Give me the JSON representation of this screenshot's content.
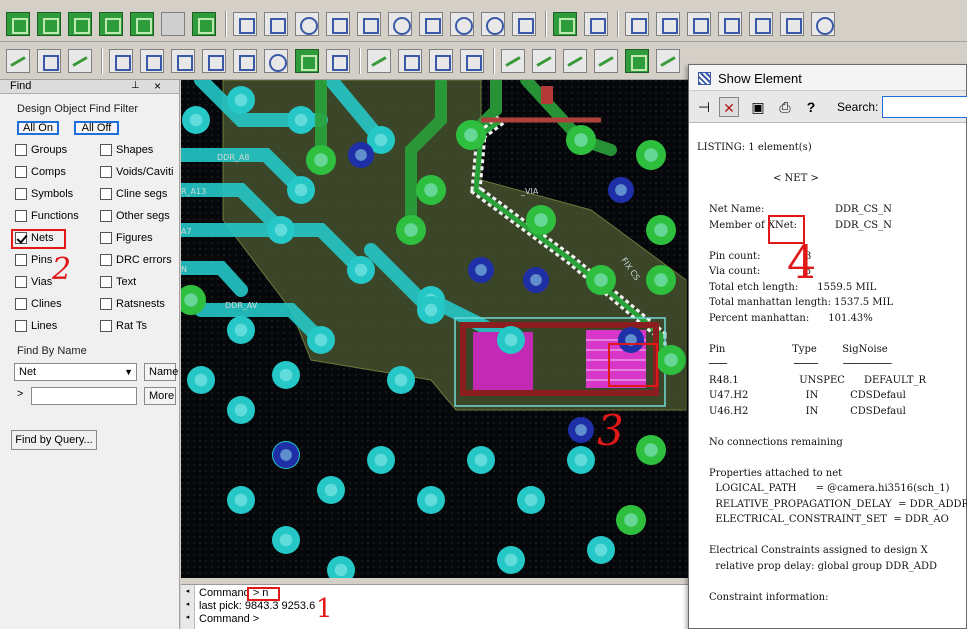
{
  "find_panel": {
    "title": "Find",
    "filter_group_label": "Design Object Find Filter",
    "all_on_label": "All On",
    "all_off_label": "All Off",
    "checkboxes_left": [
      {
        "label": "Groups",
        "checked": false
      },
      {
        "label": "Comps",
        "checked": false
      },
      {
        "label": "Symbols",
        "checked": false
      },
      {
        "label": "Functions",
        "checked": false
      },
      {
        "label": "Nets",
        "checked": true
      },
      {
        "label": "Pins",
        "checked": false
      },
      {
        "label": "Vias",
        "checked": false
      },
      {
        "label": "Clines",
        "checked": false
      },
      {
        "label": "Lines",
        "checked": false
      }
    ],
    "checkboxes_right": [
      {
        "label": "Shapes",
        "checked": false
      },
      {
        "label": "Voids/Caviti",
        "checked": false
      },
      {
        "label": "Cline segs",
        "checked": false
      },
      {
        "label": "Other segs",
        "checked": false
      },
      {
        "label": "Figures",
        "checked": false
      },
      {
        "label": "DRC errors",
        "checked": false
      },
      {
        "label": "Text",
        "checked": false
      },
      {
        "label": "Ratsnests",
        "checked": false
      },
      {
        "label": "Rat Ts",
        "checked": false
      }
    ],
    "find_by_name_label": "Find By Name",
    "type_selected": "Net",
    "name_button_label": "Name",
    "more_button_label": "More",
    "expander_symbol": ">",
    "name_input_value": "",
    "find_by_query_label": "Find by Query..."
  },
  "canvas_labels": {
    "ddr_a8": "DDR_A8",
    "ddr_a13": "R_A13",
    "a7": "A7",
    "ddr_av": "DDR_AV",
    "n_label": "N",
    "ddr_cs": "DDR_CS_N",
    "vias_text": "_VIA",
    "fix_text": "FIX CS"
  },
  "command": {
    "line1_label": "Command",
    "line1_input": "> n",
    "line2": "last pick:  9843.3 9253.6",
    "line3": "Command >"
  },
  "show_element": {
    "title": "Show Element",
    "search_label": "Search:",
    "search_value": "",
    "listing_header": "LISTING: 1 element(s)",
    "section_title": "< NET >",
    "net_name_label": "Net Name:",
    "net_name_value": "DDR_CS_N",
    "member_label": "Member of XNet:",
    "member_value": "DDR_CS_N",
    "pin_count": "Pin count:              3",
    "via_count": "Via count:              3",
    "etch_length": "Total etch length:      1559.5 MIL",
    "manhattan_length": "Total manhattan length: 1537.5 MIL",
    "percent_manhattan": "Percent manhattan:      101.43%",
    "pin_table_header": "Pin                     Type        SigNoise",
    "pin_table_rule": "───                     ────        ────────",
    "pins": [
      "R48.1                   UNSPEC      DEFAULT_R",
      "U47.H2                  IN          CDSDefaul",
      "U46.H2                  IN          CDSDefaul"
    ],
    "no_connections": "No connections remaining",
    "props_header": "Properties attached to net",
    "prop_logical_path": "  LOGICAL_PATH      = @camera.hi3516(sch_1)",
    "prop_rel_delay": "  RELATIVE_PROPAGATION_DELAY  = DDR_ADDR:G:",
    "prop_ecs": "  ELECTRICAL_CONSTRAINT_SET  = DDR_AO",
    "ec_header": "Electrical Constraints assigned to design X",
    "ec_line": "  relative prop delay: global group DDR_ADD",
    "constraint_info": "Constraint information:"
  },
  "annotations": {
    "num1": "1",
    "num2": "2",
    "num3": "3",
    "num4": "4"
  },
  "colors": {
    "via_cyan": "#25c7c7",
    "via_blue": "#1e2fa8",
    "via_green": "#2fbf3f",
    "trace_green": "#2aa23a",
    "pad_magenta": "#d836c8",
    "highlight_red": "#e01818"
  }
}
